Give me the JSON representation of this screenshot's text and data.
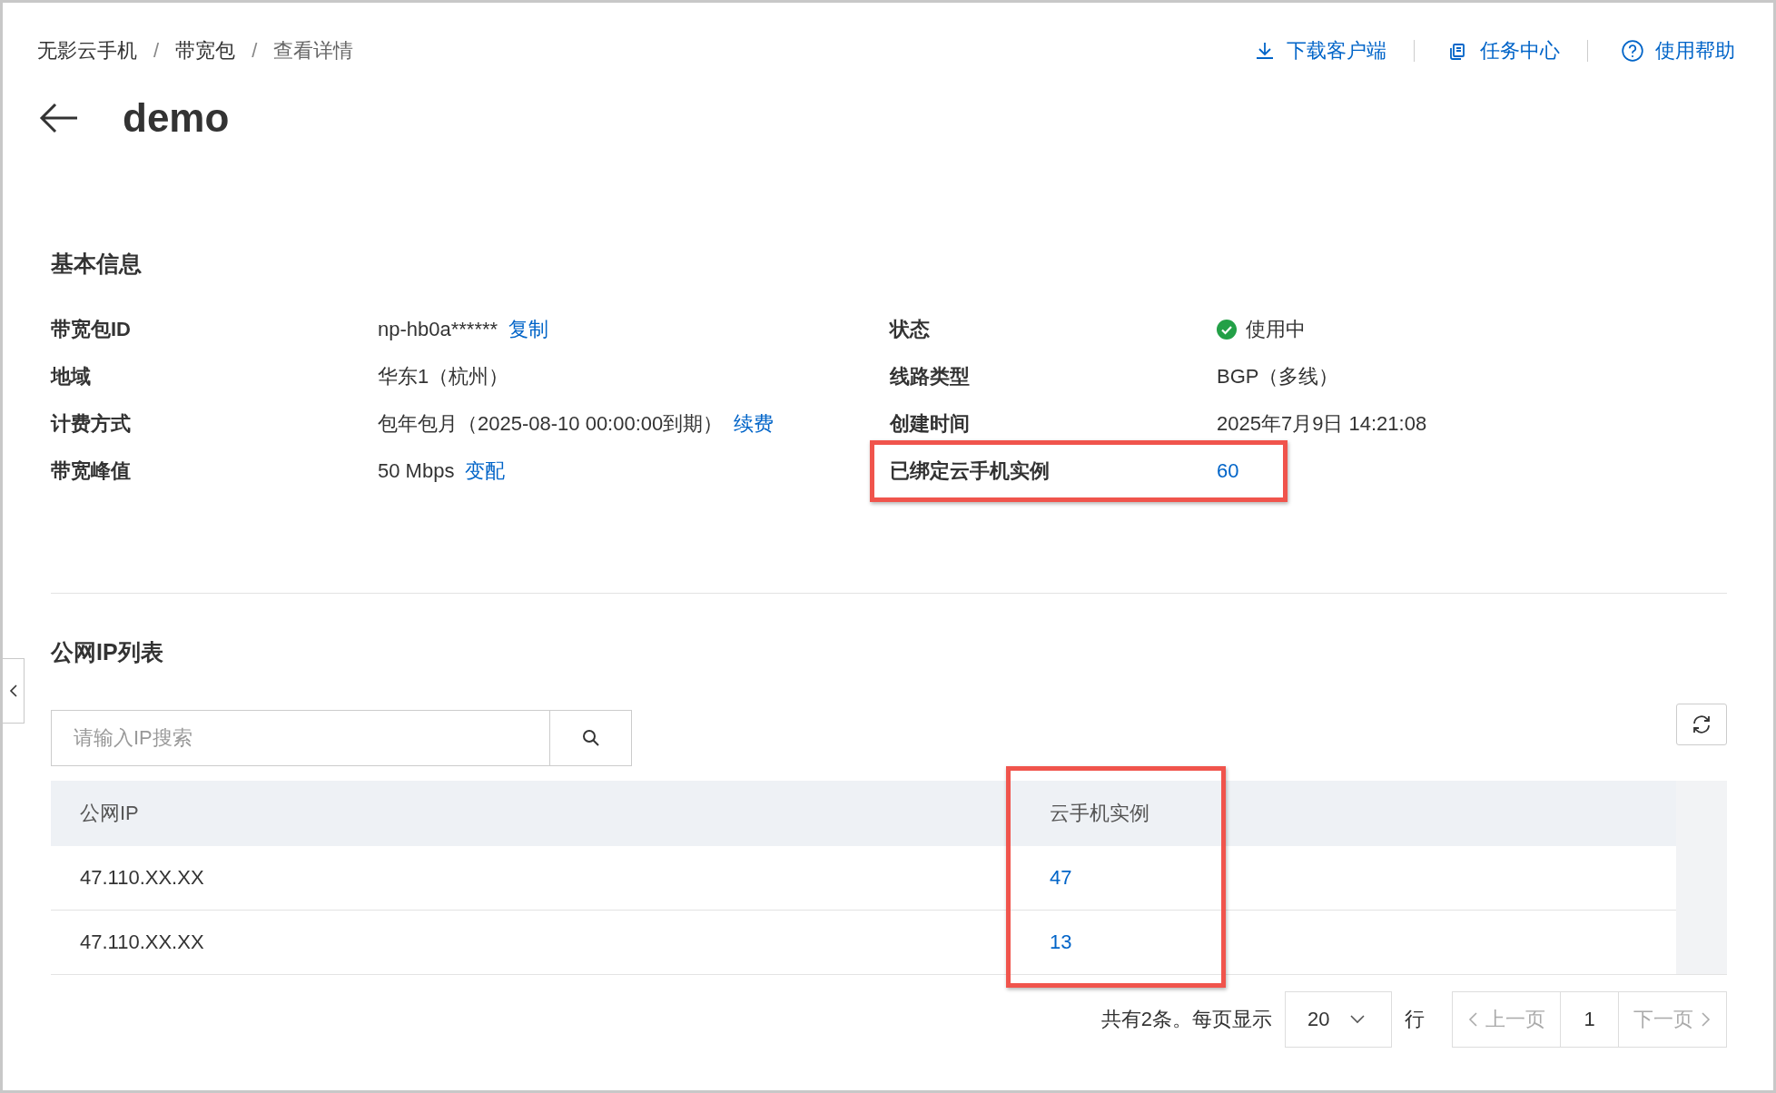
{
  "breadcrumb": [
    {
      "label": "无影云手机"
    },
    {
      "separator": "/",
      "label": "带宽包"
    },
    {
      "separator": "/",
      "label": "查看详情"
    }
  ],
  "header_links": [
    {
      "label": "下载客户端",
      "kind": "download"
    },
    {
      "label": "任务中心",
      "kind": "task"
    },
    {
      "label": "使用帮助",
      "kind": "help"
    }
  ],
  "title": "demo",
  "basic_info": {
    "heading": "基本信息",
    "fields": [
      {
        "label": "带宽包ID",
        "kind": "text",
        "value": "np-hb0a******",
        "action": "复制",
        "highlighted": false
      },
      {
        "label": "状态",
        "kind": "status",
        "value": "使用中",
        "color": "#23a047",
        "highlighted": false
      },
      {
        "label": "地域",
        "kind": "text",
        "value": "华东1（杭州）",
        "highlighted": false
      },
      {
        "label": "线路类型",
        "kind": "text",
        "value": "BGP（多线）",
        "highlighted": false
      },
      {
        "label": "计费方式",
        "kind": "text",
        "value": "包年包月（2025-08-10 00:00:00到期）",
        "action": "续费",
        "highlighted": false
      },
      {
        "label": "创建时间",
        "kind": "text",
        "value": "2025年7月9日 14:21:08",
        "highlighted": false
      },
      {
        "label": "带宽峰值",
        "kind": "text",
        "value": "50 Mbps",
        "action": "变配",
        "highlighted": false
      },
      {
        "label": "已绑定云手机实例",
        "kind": "link",
        "value": "60",
        "highlighted": true
      }
    ]
  },
  "ip_list": {
    "heading": "公网IP列表",
    "search": {
      "placeholder": "请输入IP搜索"
    },
    "columns": [
      {
        "label": "公网IP",
        "highlighted": false
      },
      {
        "label": "云手机实例",
        "highlighted": true
      }
    ],
    "rows": [
      {
        "ip": "47.110.XX.XX",
        "instances": "47"
      },
      {
        "ip": "47.110.XX.XX",
        "instances": "13"
      }
    ],
    "pagination": {
      "total": "共有2条。每页显示",
      "page_size": "20",
      "unit": "行",
      "prev": {
        "label": "上一页",
        "disabled": true
      },
      "page": "1",
      "next": {
        "label": "下一页",
        "disabled": true
      }
    }
  }
}
